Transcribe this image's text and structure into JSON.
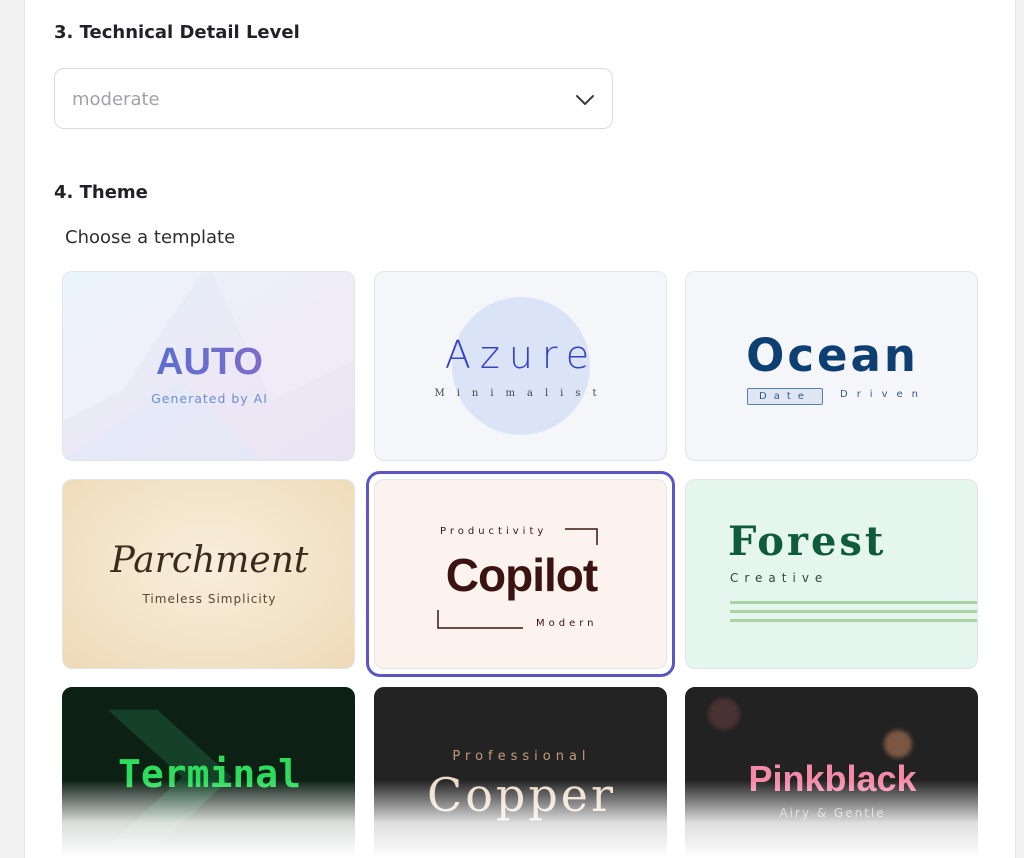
{
  "technical_detail": {
    "label": "3. Technical Detail Level",
    "value": "moderate",
    "chevron_icon": "chevron-down-icon"
  },
  "theme": {
    "label": "4. Theme",
    "subtitle": "Choose a template",
    "selected": "Copilot",
    "templates": [
      {
        "title": "AUTO",
        "tagline": "Generated by AI"
      },
      {
        "title": "Azure",
        "tagline": "Minimalist"
      },
      {
        "title": "Ocean",
        "tag1": "Date",
        "tag2": "Driven"
      },
      {
        "title": "Parchment",
        "tagline": "Timeless Simplicity"
      },
      {
        "title": "Copilot",
        "top": "Productivity",
        "bottom": "Modern"
      },
      {
        "title": "Forest",
        "tagline": "Creative"
      },
      {
        "title": "Terminal"
      },
      {
        "title": "Copper",
        "top": "Professional"
      },
      {
        "title": "Pinkblack",
        "tagline": "Airy & Gentle"
      }
    ]
  },
  "colors": {
    "accent_selected": "#5b55c7",
    "ocean_blue": "#0e3f73",
    "forest_green": "#0f5b3a",
    "copilot_brown": "#3b1412",
    "terminal_green": "#2ddc5c",
    "pink": "#f48aa9"
  }
}
